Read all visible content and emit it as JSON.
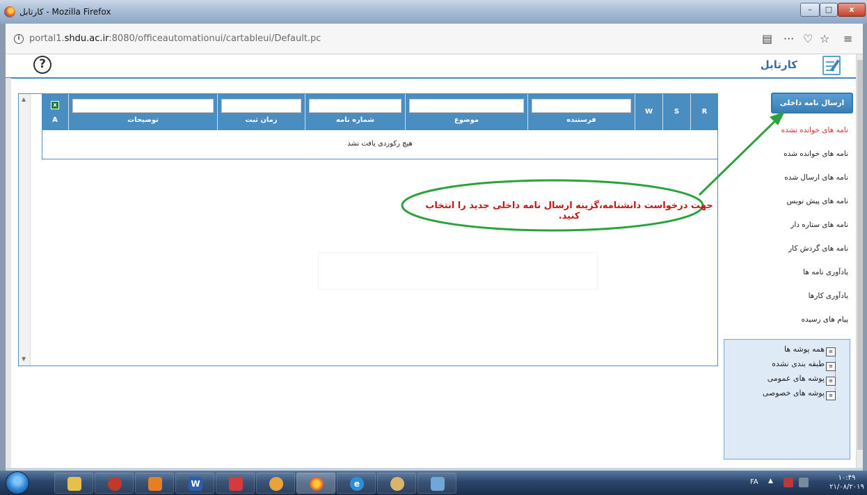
{
  "window": {
    "title": "کارتابل - Mozilla Firefox",
    "min_glyph": "–",
    "max_glyph": "□",
    "close_glyph": "x"
  },
  "browser": {
    "url_prefix": "portal1.",
    "url_domain": "shdu.ac.ir",
    "url_suffix": ":8080/officeautomationui/cartableui/Default.pc",
    "info_glyph": "i",
    "reader_glyph": "▤",
    "more_glyph": "···",
    "pocket_glyph": "♡",
    "star_glyph": "☆",
    "menu_glyph": "≡"
  },
  "page": {
    "title": "کارتابل",
    "help_glyph": "?",
    "new_letter_button": "ارسال نامه داخلی جدید",
    "annotation": "جهت درخواست دانشنامه،گزینه ارسال نامه داخلی جدید را انتخاب کنید."
  },
  "grid": {
    "excel_col_label": "A",
    "excel_glyph": "x",
    "columns": [
      "توضیحات",
      "زمان ثبت",
      "شماره نامه",
      "موضوع",
      "فرستنده",
      "W",
      "S",
      "R"
    ],
    "empty_message": "هیچ رکوردی یافت نشد"
  },
  "menu": {
    "items": [
      "نامه های خوانده نشده",
      "نامه های خوانده شده",
      "نامه های ارسال شده",
      "نامه های پیش نویس",
      "نامه های ستاره دار",
      "نامه های گردش کار",
      "یادآوری نامه ها",
      "یادآوری کارها",
      "پیام های رسیده"
    ],
    "active_color": "#d42e2e"
  },
  "folders": {
    "items": [
      "همه پوشه ها",
      "طبقه بندی نشده",
      "پوشه های عمومی",
      "پوشه های خصوصی"
    ]
  },
  "taskbar": {
    "lang": "FA",
    "tray_caret": "▲",
    "clock_time": "۱۰:۴۹",
    "clock_date": "۲۱/۰۸/۲۰۱۹"
  },
  "colors": {
    "accent": "#4a8dc1",
    "annotation_red": "#c01717",
    "annotation_green": "#2aa23a"
  }
}
